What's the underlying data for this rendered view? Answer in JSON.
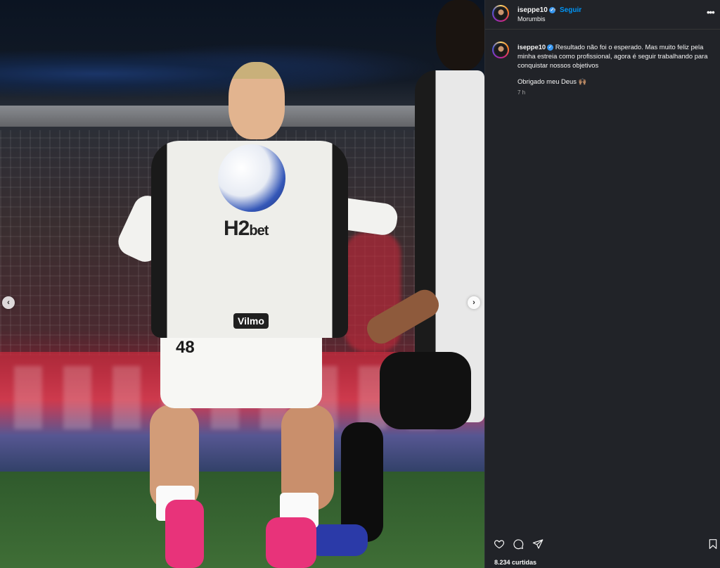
{
  "post": {
    "username": "iseppe10",
    "follow_label": "Seguir",
    "separator": "•",
    "location": "Morumbis",
    "more_label": "•••"
  },
  "caption": {
    "username": "iseppe10",
    "text": "Resultado não foi o esperado. Mas muito feliz pela minha estreia como profissional, agora é seguir trabalhando para conquistar nossos objetivos",
    "second_line": "Obrigado meu Deus 🙌🏽",
    "time": "7 h"
  },
  "media": {
    "sponsor_main": "H2",
    "sponsor_suffix": "bet",
    "sponsor_secondary": "Vilmo",
    "shirt_number": "48",
    "prev_arrow": "‹",
    "next_arrow": "›"
  },
  "actions": {
    "like_icon": "heart-icon",
    "comment_icon": "comment-icon",
    "share_icon": "share-icon",
    "save_icon": "bookmark-icon",
    "likes_text": "8.234 curtidas"
  },
  "colors": {
    "panel_bg": "#212328",
    "link_blue": "#0095f6",
    "verified_blue": "#3897f0",
    "text": "#f5f5f5",
    "muted": "#a8a8a8"
  }
}
